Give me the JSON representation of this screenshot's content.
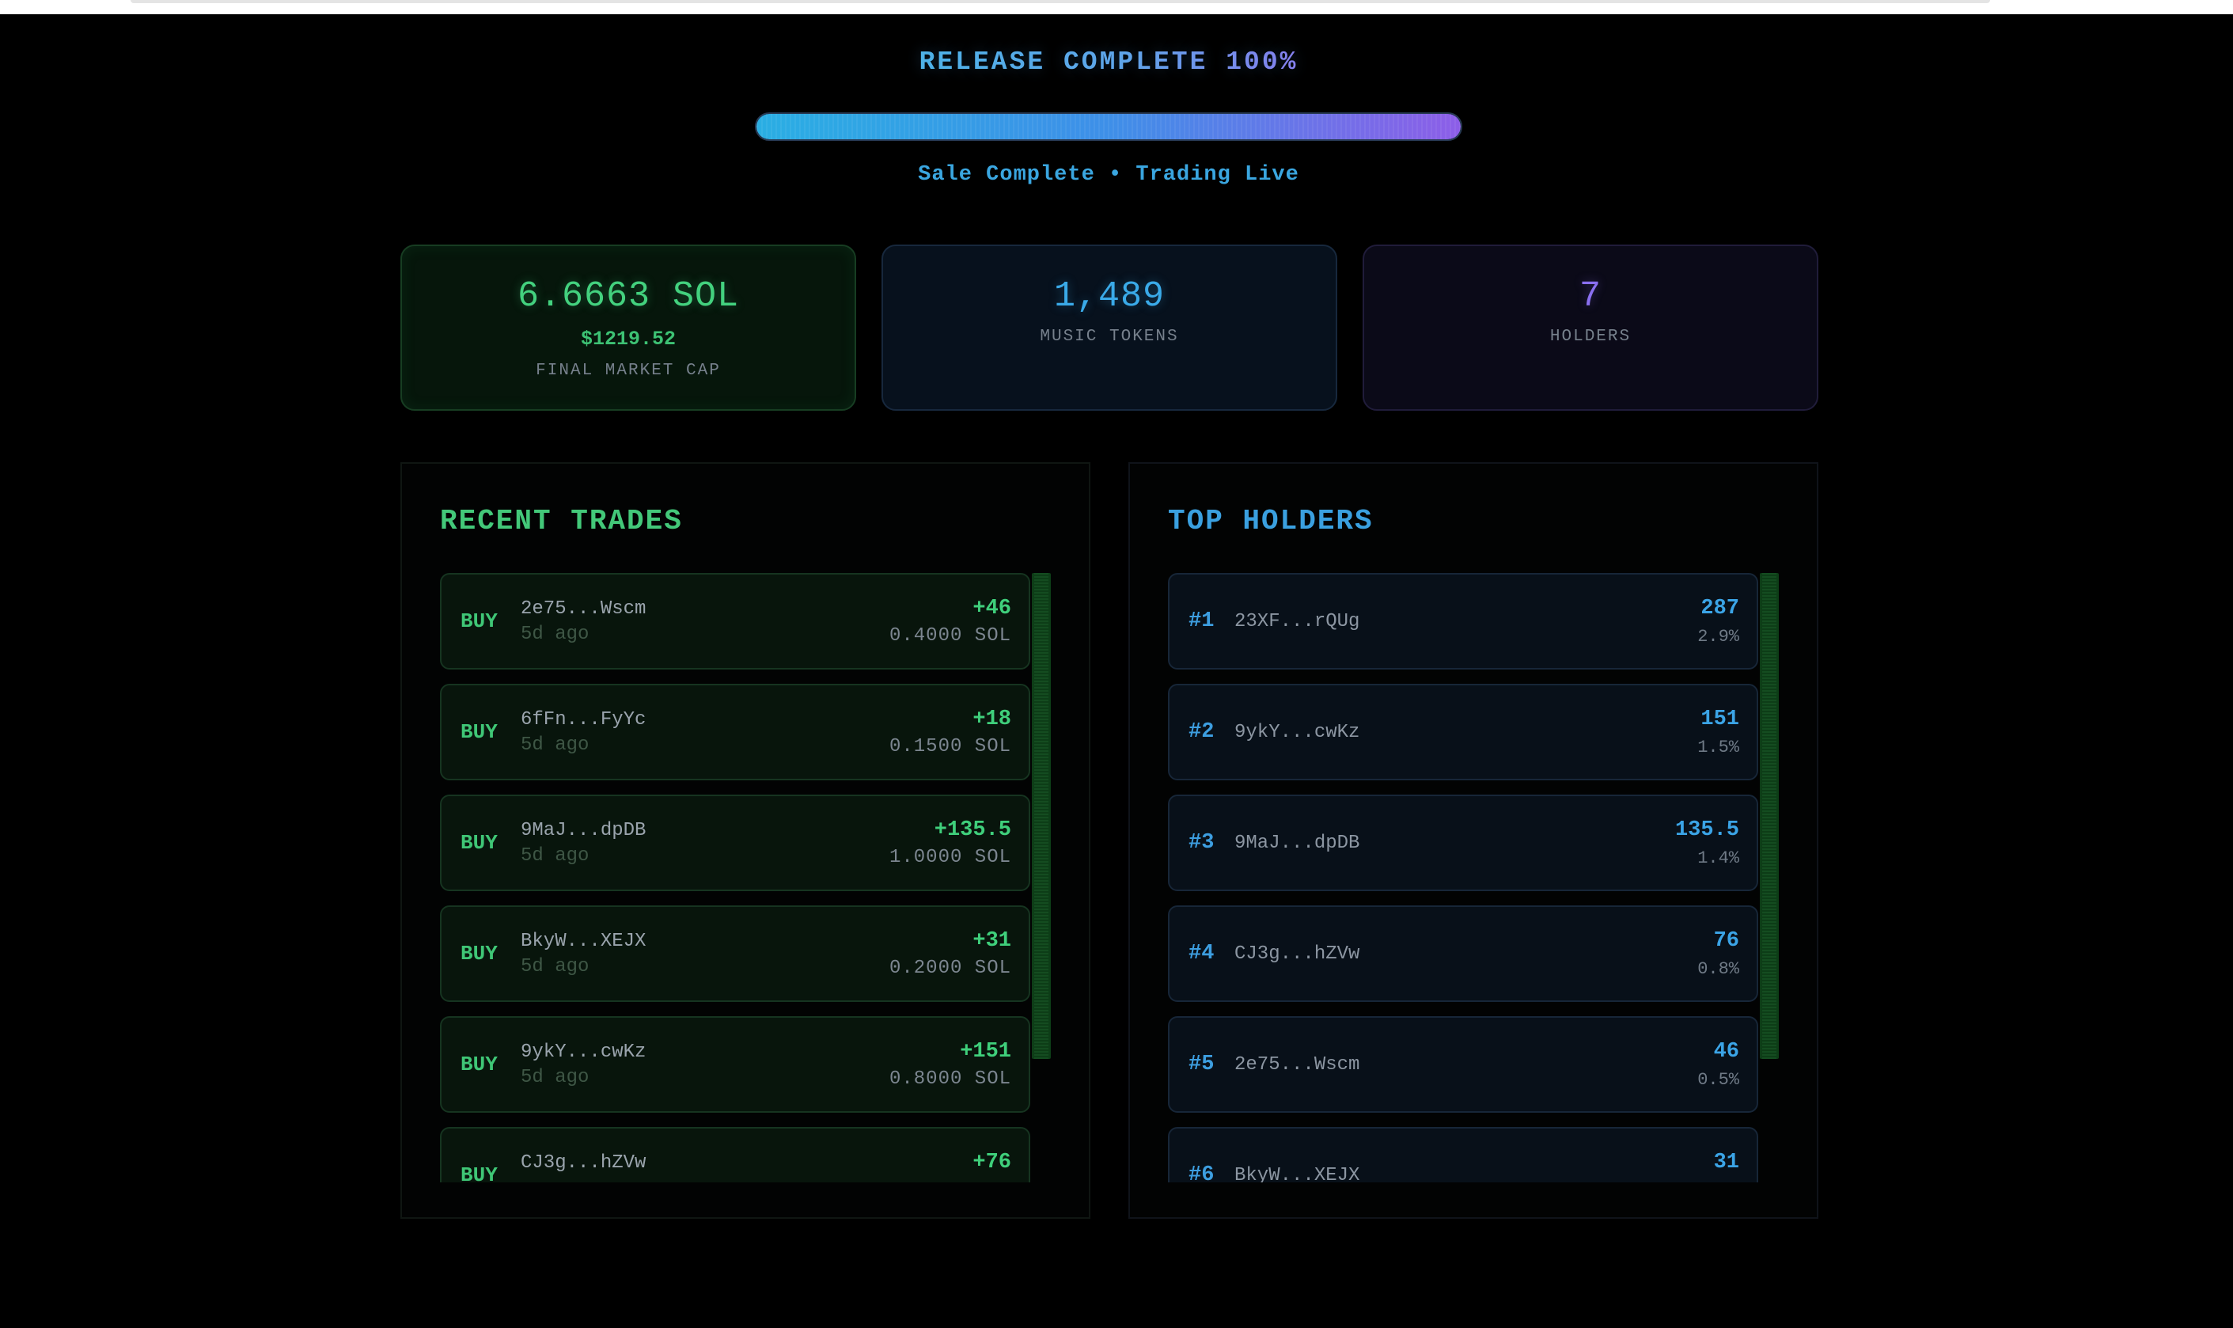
{
  "release": {
    "title": "RELEASE COMPLETE 100%",
    "progress_percent": 100,
    "subtitle": "Sale Complete • Trading Live"
  },
  "stats": {
    "market_cap": {
      "value": "6.6663 SOL",
      "usd": "$1219.52",
      "label": "FINAL MARKET CAP"
    },
    "tokens": {
      "value": "1,489",
      "label": "MUSIC TOKENS"
    },
    "holders": {
      "value": "7",
      "label": "HOLDERS"
    }
  },
  "recent_trades": {
    "title": "RECENT TRADES",
    "items": [
      {
        "type": "BUY",
        "address": "2e75...Wscm",
        "time": "5d ago",
        "amount": "+46",
        "sol": "0.4000 SOL"
      },
      {
        "type": "BUY",
        "address": "6fFn...FyYc",
        "time": "5d ago",
        "amount": "+18",
        "sol": "0.1500 SOL"
      },
      {
        "type": "BUY",
        "address": "9MaJ...dpDB",
        "time": "5d ago",
        "amount": "+135.5",
        "sol": "1.0000 SOL"
      },
      {
        "type": "BUY",
        "address": "BkyW...XEJX",
        "time": "5d ago",
        "amount": "+31",
        "sol": "0.2000 SOL"
      },
      {
        "type": "BUY",
        "address": "9ykY...cwKz",
        "time": "5d ago",
        "amount": "+151",
        "sol": "0.8000 SOL"
      },
      {
        "type": "BUY",
        "address": "CJ3g...hZVw",
        "time": "",
        "amount": "+76",
        "sol": ""
      }
    ]
  },
  "top_holders": {
    "title": "TOP HOLDERS",
    "items": [
      {
        "rank": "#1",
        "address": "23XF...rQUg",
        "amount": "287",
        "percent": "2.9%"
      },
      {
        "rank": "#2",
        "address": "9ykY...cwKz",
        "amount": "151",
        "percent": "1.5%"
      },
      {
        "rank": "#3",
        "address": "9MaJ...dpDB",
        "amount": "135.5",
        "percent": "1.4%"
      },
      {
        "rank": "#4",
        "address": "CJ3g...hZVw",
        "amount": "76",
        "percent": "0.8%"
      },
      {
        "rank": "#5",
        "address": "2e75...Wscm",
        "amount": "46",
        "percent": "0.5%"
      },
      {
        "rank": "#6",
        "address": "BkyW...XEJX",
        "amount": "31",
        "percent": ""
      }
    ]
  },
  "colors": {
    "background": "#000000",
    "green_accent": "#43d17e",
    "blue_accent": "#3aaae8",
    "purple_accent": "#8a6ff0"
  }
}
